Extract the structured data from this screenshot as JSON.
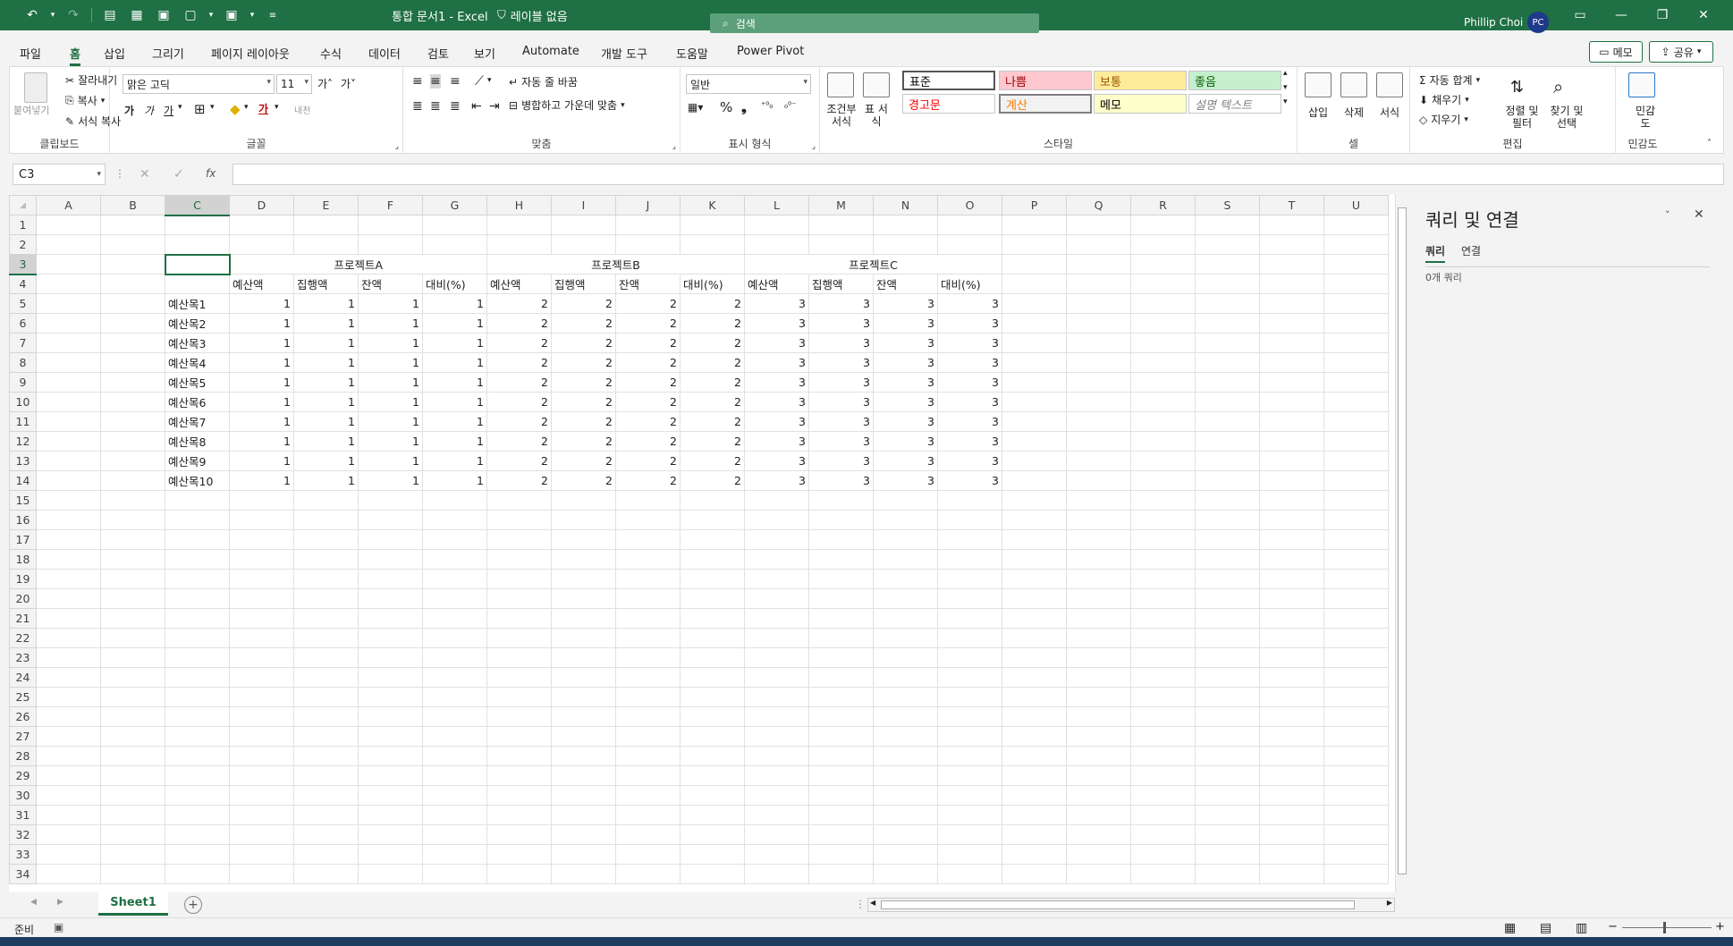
{
  "titlebar": {
    "doc_title": "통합 문서1  -  Excel",
    "label_status": "레이블 없음",
    "search_placeholder": "검색",
    "user_name": "Phillip Choi",
    "avatar_initials": "PC"
  },
  "menu": {
    "tabs": [
      "파일",
      "홈",
      "삽입",
      "그리기",
      "페이지 레이아웃",
      "수식",
      "데이터",
      "검토",
      "보기",
      "Automate",
      "개발 도구",
      "도움말",
      "Power Pivot"
    ],
    "active": "홈",
    "memo": "메모",
    "share": "공유"
  },
  "ribbon": {
    "clipboard": {
      "label": "클립보드",
      "paste": "붙여넣기",
      "cut": "잘라내기",
      "copy": "복사",
      "format_painter": "서식 복사"
    },
    "font": {
      "label": "글꼴",
      "font_name": "맑은 고딕",
      "font_size": "11",
      "bold": "가",
      "italic": "가",
      "underline": "가",
      "phonetic": "내천"
    },
    "alignment": {
      "label": "맞춤",
      "wrap": "자동 줄 바꿈",
      "merge": "병합하고 가운데 맞춤"
    },
    "number": {
      "label": "표시 형식",
      "format": "일반"
    },
    "styles": {
      "label": "스타일",
      "conditional": "조건부 서식",
      "table": "표 서식",
      "cells": [
        {
          "text": "표준",
          "bg": "#ffffff",
          "fg": "#000000"
        },
        {
          "text": "나쁨",
          "bg": "#ffc7ce",
          "fg": "#9c0006"
        },
        {
          "text": "보통",
          "bg": "#ffeb9c",
          "fg": "#9c5700"
        },
        {
          "text": "좋음",
          "bg": "#c6efce",
          "fg": "#006100"
        },
        {
          "text": "경고문",
          "bg": "#ffffff",
          "fg": "#ff0000"
        },
        {
          "text": "계산",
          "bg": "#f2f2f2",
          "fg": "#fa7d00"
        },
        {
          "text": "메모",
          "bg": "#ffffcc",
          "fg": "#000000"
        },
        {
          "text": "설명 텍스트",
          "bg": "#ffffff",
          "fg": "#7f7f7f"
        }
      ]
    },
    "cells": {
      "label": "셀",
      "insert": "삽입",
      "delete": "삭제",
      "format": "서식"
    },
    "editing": {
      "label": "편집",
      "autosum": "자동 합계",
      "fill": "채우기",
      "clear": "지우기",
      "sort_filter": "정렬 및 필터",
      "find_select": "찾기 및 선택"
    },
    "sensitivity": {
      "label": "민감도",
      "button": "민감도"
    }
  },
  "formula_bar": {
    "name_box": "C3",
    "formula": ""
  },
  "sheet": {
    "columns": [
      "A",
      "B",
      "C",
      "D",
      "E",
      "F",
      "G",
      "H",
      "I",
      "J",
      "K",
      "L",
      "M",
      "N",
      "O",
      "P",
      "Q",
      "R",
      "S",
      "T",
      "U"
    ],
    "selected_column": "C",
    "selected_row": 3,
    "projects": [
      "프로젝트A",
      "프로젝트B",
      "프로젝트C"
    ],
    "sub_headers": [
      "예산액",
      "집행액",
      "잔액",
      "대비(%)"
    ],
    "rows": [
      {
        "label": "예산목1",
        "values": [
          1,
          1,
          1,
          1,
          2,
          2,
          2,
          2,
          3,
          3,
          3,
          3
        ]
      },
      {
        "label": "예산목2",
        "values": [
          1,
          1,
          1,
          1,
          2,
          2,
          2,
          2,
          3,
          3,
          3,
          3
        ]
      },
      {
        "label": "예산목3",
        "values": [
          1,
          1,
          1,
          1,
          2,
          2,
          2,
          2,
          3,
          3,
          3,
          3
        ]
      },
      {
        "label": "예산목4",
        "values": [
          1,
          1,
          1,
          1,
          2,
          2,
          2,
          2,
          3,
          3,
          3,
          3
        ]
      },
      {
        "label": "예산목5",
        "values": [
          1,
          1,
          1,
          1,
          2,
          2,
          2,
          2,
          3,
          3,
          3,
          3
        ]
      },
      {
        "label": "예산목6",
        "values": [
          1,
          1,
          1,
          1,
          2,
          2,
          2,
          2,
          3,
          3,
          3,
          3
        ]
      },
      {
        "label": "예산목7",
        "values": [
          1,
          1,
          1,
          1,
          2,
          2,
          2,
          2,
          3,
          3,
          3,
          3
        ]
      },
      {
        "label": "예산목8",
        "values": [
          1,
          1,
          1,
          1,
          2,
          2,
          2,
          2,
          3,
          3,
          3,
          3
        ]
      },
      {
        "label": "예산목9",
        "values": [
          1,
          1,
          1,
          1,
          2,
          2,
          2,
          2,
          3,
          3,
          3,
          3
        ]
      },
      {
        "label": "예산목10",
        "values": [
          1,
          1,
          1,
          1,
          2,
          2,
          2,
          2,
          3,
          3,
          3,
          3
        ]
      }
    ],
    "total_rows": 34,
    "tab_name": "Sheet1"
  },
  "statusbar": {
    "status": "준비"
  },
  "panel": {
    "title": "쿼리 및 연결",
    "tabs": [
      "쿼리",
      "연결"
    ],
    "active_tab": "쿼리",
    "query_count": "0개 쿼리"
  }
}
